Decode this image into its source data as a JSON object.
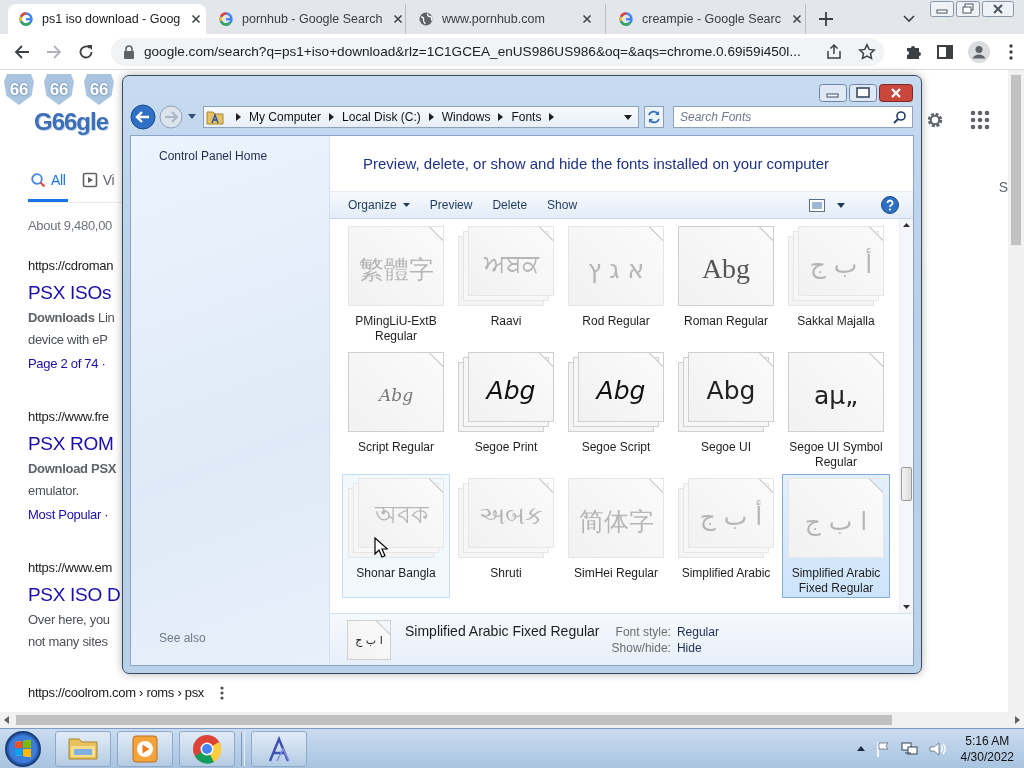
{
  "browser": {
    "tabs": [
      {
        "title": "ps1 iso download - Goog",
        "kind": "google",
        "selected": true
      },
      {
        "title": "pornhub - Google Search",
        "kind": "google",
        "selected": false
      },
      {
        "title": "www.pornhub.com",
        "kind": "globe",
        "selected": false
      },
      {
        "title": "creampie - Google Searc",
        "kind": "google",
        "selected": false
      }
    ],
    "address": "google.com/search?q=ps1+iso+download&rlz=1C1GCEA_enUS986US986&oq=&aqs=chrome.0.69i59i450l..."
  },
  "google": {
    "doodle_shields": [
      "66",
      "66",
      "66"
    ],
    "logo": "G66gle",
    "search_tabs": [
      {
        "label": "All",
        "selected": true
      },
      {
        "label": "Vi",
        "selected": false
      }
    ],
    "right_tab": "S",
    "result_stats": "About 9,480,00",
    "results": [
      {
        "url": "https://cdroman",
        "title": "PSX ISOs",
        "snippet": [
          "**Downloads** Lin",
          "device with eP"
        ],
        "link": "Page 2 of 74 ·"
      },
      {
        "url": "https://www.fre",
        "title": "PSX ROM",
        "snippet": [
          "**Download PSX**",
          "emulator."
        ],
        "link": "Most Popular ·"
      },
      {
        "url": "https://www.em",
        "title": "PSX ISO D",
        "snippet": [
          "Over here, you",
          "not many sites"
        ]
      },
      {
        "url": "https://coolrom.com › roms › psx"
      }
    ]
  },
  "explorer": {
    "breadcrumb": [
      "My Computer",
      "Local Disk (C:)",
      "Windows",
      "Fonts"
    ],
    "search": {
      "placeholder": "Search Fonts"
    },
    "nav_links": [
      "Control Panel Home"
    ],
    "see_also": "See also",
    "heading": "Preview, delete, or show and hide the fonts installed on your computer",
    "toolbar": [
      {
        "label": "Organize",
        "menu": true
      },
      {
        "label": "Preview",
        "menu": false
      },
      {
        "label": "Delete",
        "menu": false
      },
      {
        "label": "Show",
        "menu": false
      }
    ],
    "fonts": [
      {
        "name": "PMingLiU-ExtB Regular",
        "sample": "繁體字",
        "kind": "sans",
        "stacked": false,
        "hidden": true,
        "hovered": false,
        "selected": false
      },
      {
        "name": "Raavi",
        "sample": "ਅਬਕ",
        "kind": "sans",
        "stacked": true,
        "hidden": true,
        "hovered": false,
        "selected": false
      },
      {
        "name": "Rod Regular",
        "sample": "א ג ץ",
        "kind": "sans",
        "stacked": false,
        "hidden": true,
        "hovered": false,
        "selected": false
      },
      {
        "name": "Roman Regular",
        "sample": "Abg",
        "kind": "serif",
        "stacked": false,
        "hidden": false,
        "hovered": false,
        "selected": false
      },
      {
        "name": "Sakkal Majalla",
        "sample": "أ ب ج",
        "kind": "sans",
        "stacked": true,
        "hidden": true,
        "hovered": false,
        "selected": false
      },
      {
        "name": "Script Regular",
        "sample": "Abg",
        "kind": "thin",
        "stacked": false,
        "hidden": false,
        "hovered": false,
        "selected": false
      },
      {
        "name": "Segoe Print",
        "sample": "Abg",
        "kind": "hand",
        "stacked": true,
        "hidden": false,
        "hovered": false,
        "selected": false
      },
      {
        "name": "Segoe Script",
        "sample": "Abg",
        "kind": "hand",
        "stacked": true,
        "hidden": false,
        "hovered": false,
        "selected": false
      },
      {
        "name": "Segoe UI",
        "sample": "Abg",
        "kind": "sans",
        "stacked": true,
        "hidden": false,
        "hovered": false,
        "selected": false
      },
      {
        "name": "Segoe UI Symbol Regular",
        "sample": "aμ„",
        "kind": "sans",
        "stacked": false,
        "hidden": false,
        "hovered": false,
        "selected": false
      },
      {
        "name": "Shonar Bangla",
        "sample": "অবক",
        "kind": "sans",
        "stacked": true,
        "hidden": true,
        "hovered": true,
        "selected": false
      },
      {
        "name": "Shruti",
        "sample": "અબક",
        "kind": "sans",
        "stacked": true,
        "hidden": true,
        "hovered": false,
        "selected": false
      },
      {
        "name": "SimHei Regular",
        "sample": "简体字",
        "kind": "sans",
        "stacked": false,
        "hidden": true,
        "hovered": false,
        "selected": false
      },
      {
        "name": "Simplified Arabic",
        "sample": "أ ب ج",
        "kind": "sans",
        "stacked": true,
        "hidden": true,
        "hovered": false,
        "selected": false
      },
      {
        "name": "Simplified Arabic Fixed Regular",
        "sample": "ا  ب  ج",
        "kind": "sans",
        "stacked": false,
        "hidden": true,
        "hovered": false,
        "selected": true
      }
    ],
    "details": {
      "sample": "ا ب ج",
      "name": "Simplified Arabic Fixed Regular",
      "properties": [
        {
          "label": "Font style:",
          "value": "Regular"
        },
        {
          "label": "Show/hide:",
          "value": "Hide"
        }
      ]
    }
  },
  "taskbar": {
    "apps": [
      {
        "kind": "folder"
      },
      {
        "kind": "media"
      },
      {
        "kind": "chrome"
      },
      {
        "kind": "fonts"
      }
    ],
    "time": "5:16 AM",
    "date": "4/30/2022"
  }
}
